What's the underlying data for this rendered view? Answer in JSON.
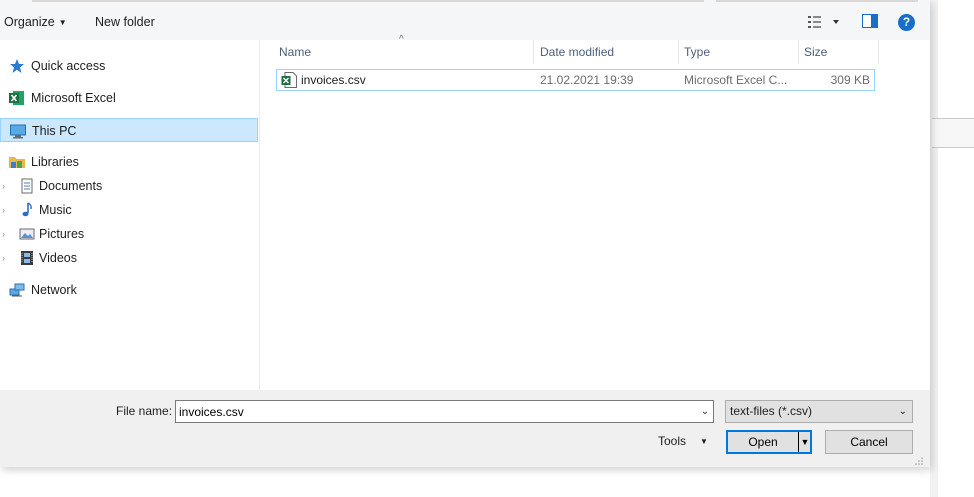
{
  "toolbar": {
    "organize_label": "Organize",
    "new_folder_label": "New folder",
    "view_icon": "view-options-icon",
    "pane_icon": "preview-pane-icon",
    "help_label": "?"
  },
  "nav": {
    "items": [
      {
        "label": "Quick access",
        "icon": "star-icon"
      },
      {
        "label": "Microsoft Excel",
        "icon": "excel-icon"
      },
      {
        "label": "This PC",
        "icon": "computer-icon"
      },
      {
        "label": "Libraries",
        "icon": "folder-icon"
      },
      {
        "label": "Documents",
        "icon": "documents-icon"
      },
      {
        "label": "Music",
        "icon": "music-icon"
      },
      {
        "label": "Pictures",
        "icon": "pictures-icon"
      },
      {
        "label": "Videos",
        "icon": "videos-icon"
      },
      {
        "label": "Network",
        "icon": "network-icon"
      }
    ]
  },
  "columns": {
    "name": "Name",
    "date_modified": "Date modified",
    "type": "Type",
    "size": "Size"
  },
  "files": [
    {
      "name": "invoices.csv",
      "date_modified": "21.02.2021 19:39",
      "type": "Microsoft Excel C...",
      "size": "309 KB"
    }
  ],
  "bottom": {
    "file_name_label": "File name:",
    "file_name_value": "invoices.csv",
    "file_type_value": "text-files (*.csv)",
    "tools_label": "Tools",
    "open_label": "Open",
    "cancel_label": "Cancel"
  },
  "colors": {
    "selection_bg": "#cce8ff",
    "selection_border": "#99d1ff",
    "accent": "#0078d7",
    "excel_green": "#1d6f42"
  }
}
